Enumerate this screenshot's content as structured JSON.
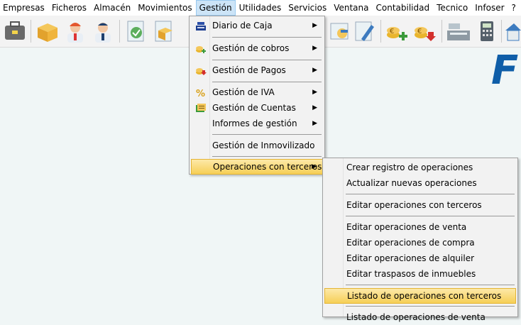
{
  "menubar": {
    "items": [
      {
        "label": "Empresas",
        "active": false
      },
      {
        "label": "Ficheros",
        "active": false
      },
      {
        "label": "Almacén",
        "active": false
      },
      {
        "label": "Movimientos",
        "active": false
      },
      {
        "label": "Gestión",
        "active": true
      },
      {
        "label": "Utilidades",
        "active": false
      },
      {
        "label": "Servicios",
        "active": false
      },
      {
        "label": "Ventana",
        "active": false
      },
      {
        "label": "Contabilidad",
        "active": false
      },
      {
        "label": "Tecnico",
        "active": false
      },
      {
        "label": "Infoser",
        "active": false
      },
      {
        "label": "?",
        "active": false
      }
    ]
  },
  "gestion_menu": {
    "items": [
      {
        "label": "Diario de Caja",
        "icon": "cash-register-icon",
        "submenu": true
      },
      {
        "label": "Gestión de cobros",
        "icon": "coins-plus-icon",
        "submenu": true
      },
      {
        "label": "Gestión de Pagos",
        "icon": "coins-down-icon",
        "submenu": true
      },
      {
        "label": "Gestión de IVA",
        "icon": "percent-icon",
        "submenu": true
      },
      {
        "label": "Gestión de Cuentas",
        "icon": "ledger-icon",
        "submenu": true
      },
      {
        "label": "Informes de gestión",
        "icon": "",
        "submenu": true
      },
      {
        "label": "Gestión de Inmovilizado",
        "icon": "",
        "submenu": false
      },
      {
        "label": "Operaciones con terceros",
        "icon": "",
        "submenu": true
      }
    ]
  },
  "terceros_submenu": {
    "items": [
      "Crear registro de operaciones",
      "Actualizar nuevas operaciones",
      "Editar operaciones con terceros",
      "Editar operaciones de venta",
      "Editar operaciones de compra",
      "Editar operaciones de alquiler",
      "Editar traspasos de inmuebles",
      "Listado de operaciones con terceros",
      "Listado de operaciones de venta"
    ]
  },
  "colors": {
    "highlight_top": "#fde9a8",
    "highlight_bottom": "#f6cf57",
    "logo": "#0f5ea8"
  }
}
